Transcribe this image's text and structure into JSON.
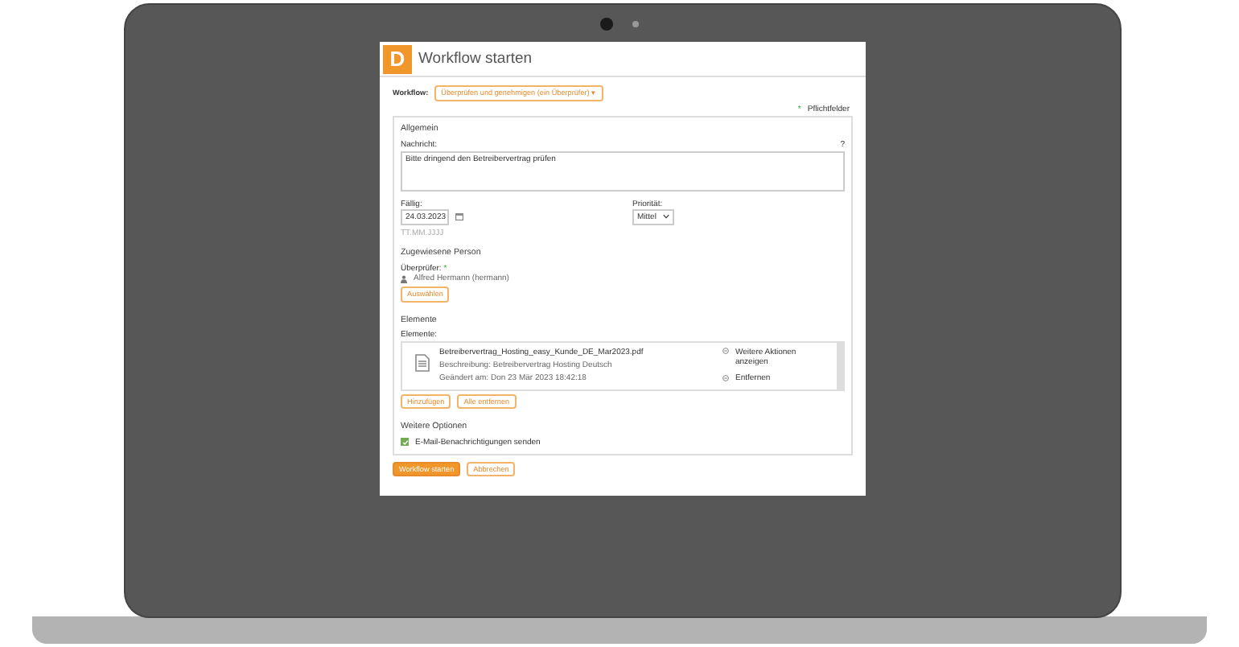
{
  "window": {
    "logo": "D",
    "title": "Workflow starten"
  },
  "workflow": {
    "label": "Workflow:",
    "value": "Überprüfen und genehmigen (ein Überprüfer)",
    "caret": "▾"
  },
  "required_note": {
    "mark": "*",
    "text": "Pflichtfelder"
  },
  "general": {
    "legend": "Allgemein",
    "message_label": "Nachricht:",
    "help": "?",
    "message": "Bitte dringend den Betreibervertrag prüfen",
    "due_label": "Fällig:",
    "due_value": "24.03.2023",
    "due_hint": "TT.MM.JJJJ",
    "priority_label": "Priorität:",
    "priority_value": "Mittel"
  },
  "assignee": {
    "legend": "Zugewiesene Person",
    "reviewer_label": "Überprüfer:",
    "required_mark": "*",
    "person": "Alfred Hermann (hermann)",
    "select_button": "Auswählen"
  },
  "items": {
    "legend": "Elemente",
    "label": "Elemente:",
    "files": [
      {
        "name": "Betreibervertrag_Hosting_easy_Kunde_DE_Mar2023.pdf",
        "description": "Beschreibung: Betreibervertrag Hosting Deutsch",
        "modified": "Geändert am: Don 23 Mär 2023 18:42:18",
        "actions": [
          "Weitere Aktionen anzeigen",
          "Entfernen"
        ]
      }
    ],
    "buttons": [
      "Hinzufügen",
      "Alle entfernen"
    ]
  },
  "options": {
    "legend": "Weitere Optionen",
    "checkboxes": [
      {
        "label": "E-Mail-Benachrichtigungen senden",
        "checked": true
      }
    ]
  },
  "buttons": [
    {
      "label": "Workflow starten",
      "kind": "primary"
    },
    {
      "label": "Abbrechen",
      "kind": "secondary"
    }
  ]
}
